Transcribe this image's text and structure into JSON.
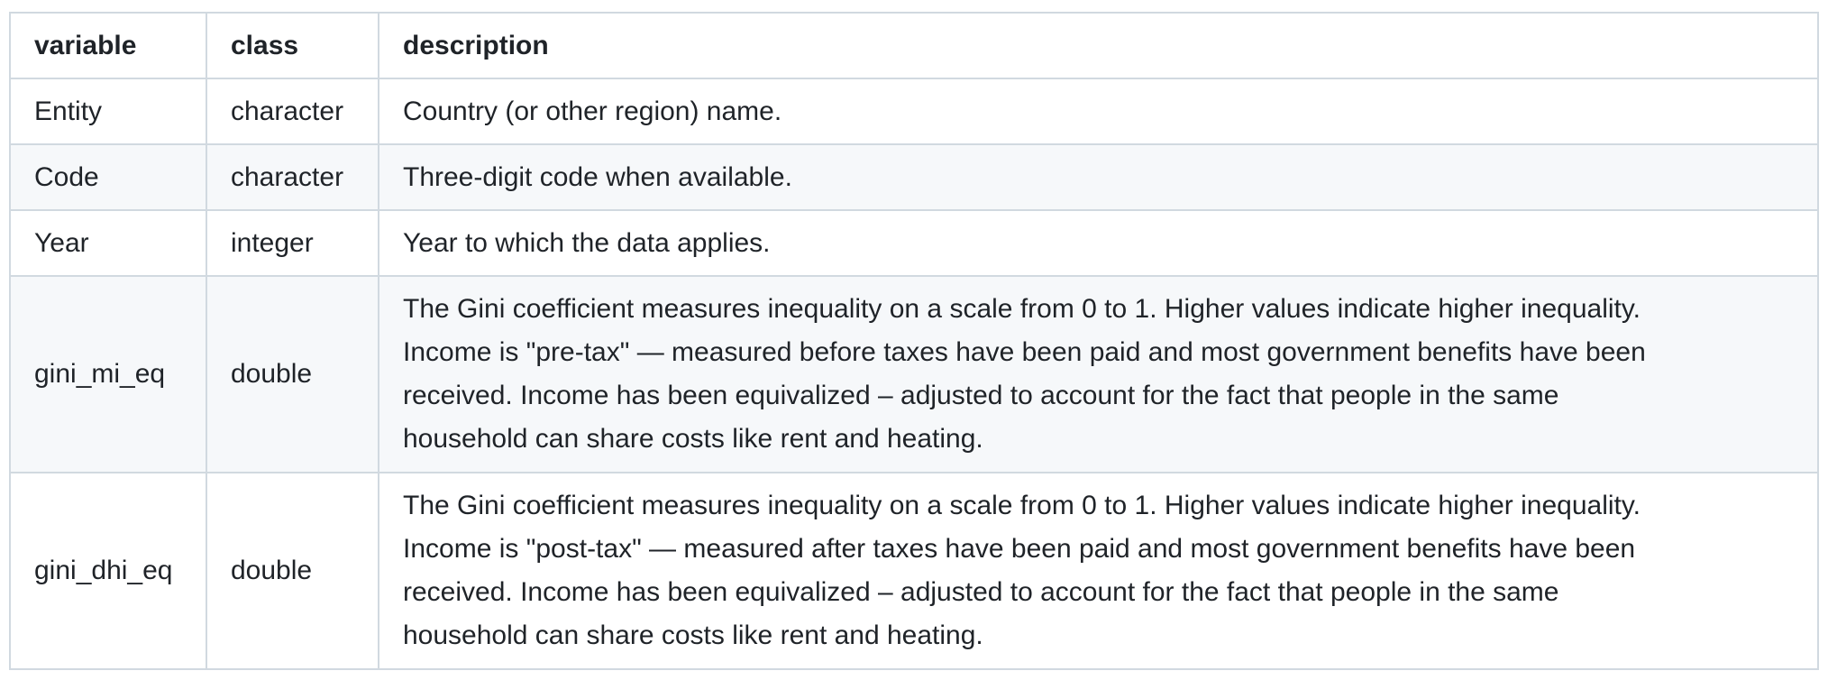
{
  "table": {
    "headers": [
      "variable",
      "class",
      "description"
    ],
    "rows": [
      {
        "variable": "Entity",
        "class": "character",
        "description": [
          "Country (or other region) name."
        ]
      },
      {
        "variable": "Code",
        "class": "character",
        "description": [
          "Three-digit code when available."
        ]
      },
      {
        "variable": "Year",
        "class": "integer",
        "description": [
          "Year to which the data applies."
        ]
      },
      {
        "variable": "gini_mi_eq",
        "class": "double",
        "description": [
          "The Gini coefficient measures inequality on a scale from 0 to 1. Higher values indicate higher inequality.",
          "Income is \"pre-tax\" — measured before taxes have been paid and most government benefits have been",
          "received. Income has been equivalized – adjusted to account for the fact that people in the same",
          "household can share costs like rent and heating."
        ]
      },
      {
        "variable": "gini_dhi_eq",
        "class": "double",
        "description": [
          "The Gini coefficient measures inequality on a scale from 0 to 1. Higher values indicate higher inequality.",
          "Income is \"post-tax\" — measured after taxes have been paid and most government benefits have been",
          "received. Income has been equivalized – adjusted to account for the fact that people in the same",
          "household can share costs like rent and heating."
        ]
      }
    ]
  }
}
